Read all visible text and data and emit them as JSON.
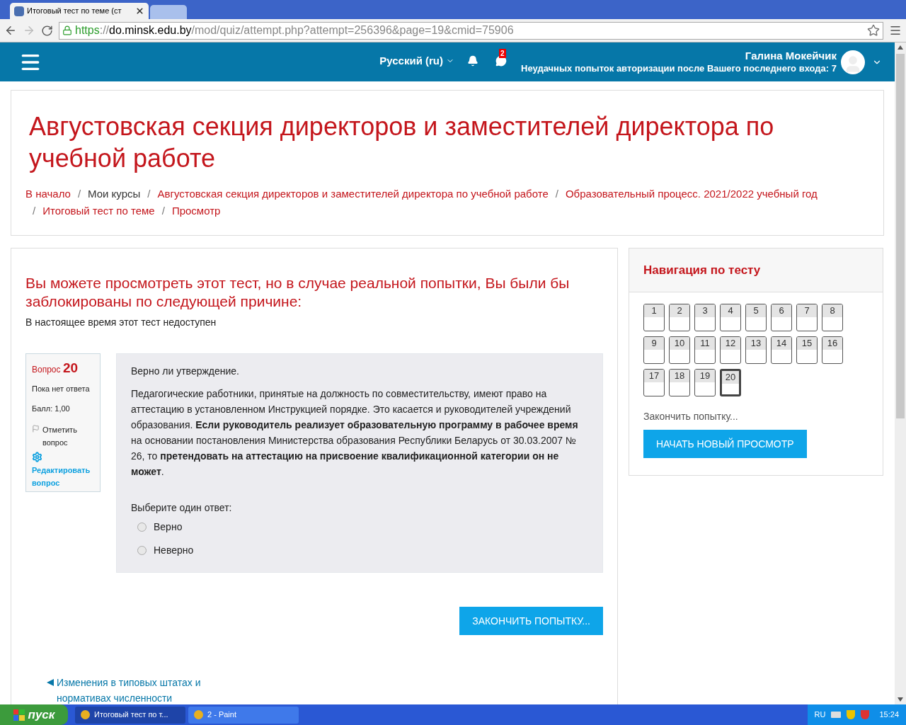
{
  "browser": {
    "tabs": [
      {
        "title": "Итоговый тест по теме (ст",
        "selected": true
      },
      {
        "selected": false
      }
    ],
    "url": {
      "scheme": "https",
      "separator": "://",
      "host": "do.minsk.edu.by",
      "path": "/mod/quiz/attempt.php?attempt=256396&page=19&cmid=75906"
    }
  },
  "navbar": {
    "language": "Русский (ru)",
    "message_count": "2",
    "user_name": "Галина Мокейчик",
    "login_notice": "Неудачных попыток авторизации после Вашего последнего входа: 7"
  },
  "header": {
    "title": "Августовская секция директоров и заместителей директора по учебной работе",
    "breadcrumbs": [
      {
        "label": "В начало",
        "link": true
      },
      {
        "separator": "/",
        "label": "Мои курсы",
        "link": false
      },
      {
        "separator": "/",
        "label": "Августовская секция директоров и заместителей директора по учебной работе",
        "link": true
      },
      {
        "separator": "/",
        "label": "Образовательный процесс. 2021/2022 учебный год",
        "link": true
      },
      {
        "separator": "/",
        "label": "Итоговый тест по теме",
        "link": true
      },
      {
        "separator": "/",
        "label": "Просмотр",
        "link": true
      }
    ]
  },
  "quiz": {
    "notice_title": "Вы можете просмотреть этот тест, но в случае реальной попытки, Вы были бы заблокированы по следующей причине:",
    "notice_text": "В настоящее время этот тест недоступен",
    "info": {
      "label": "Вопрос",
      "number": "20",
      "status": "Пока нет ответа",
      "grade": "Балл: 1,00",
      "flag": "Отметить вопрос",
      "edit": "Редактировать вопрос"
    },
    "question": {
      "intro": "Верно ли утверждение.",
      "text": "Педагогические работники, принятые на должность по совместительству, имеют право на аттестацию в установленном Инструкцией порядке. Это касается и руководителей учреждений образования. **Если руководитель реализует образовательную программу в рабочее время** на основании постановления Министерства образования Республики Беларусь от 30.03.2007 № 26, то **претендовать на аттестацию на присвоение квалификационной категории он не может**.",
      "prompt": "Выберите один ответ:",
      "answers": [
        {
          "label": "Верно",
          "selected": false
        },
        {
          "label": "Неверно",
          "selected": false
        }
      ]
    },
    "finish_button": "ЗАКОНЧИТЬ ПОПЫТКУ...",
    "prev_link": "Изменения в типовых штатах и нормативах численности"
  },
  "navigation": {
    "title": "Навигация по тесту",
    "buttons": [
      {
        "label": "1",
        "selected": false
      },
      {
        "label": "2",
        "selected": false
      },
      {
        "label": "3",
        "selected": false
      },
      {
        "label": "4",
        "selected": false
      },
      {
        "label": "5",
        "selected": false
      },
      {
        "label": "6",
        "selected": false
      },
      {
        "label": "7",
        "selected": false
      },
      {
        "label": "8",
        "selected": false
      },
      {
        "label": "9",
        "selected": false
      },
      {
        "label": "10",
        "selected": false
      },
      {
        "label": "11",
        "selected": false
      },
      {
        "label": "12",
        "selected": false
      },
      {
        "label": "13",
        "selected": false
      },
      {
        "label": "14",
        "selected": false
      },
      {
        "label": "15",
        "selected": false
      },
      {
        "label": "16",
        "selected": false
      },
      {
        "label": "17",
        "selected": false
      },
      {
        "label": "18",
        "selected": false
      },
      {
        "label": "19",
        "selected": false
      },
      {
        "label": "20",
        "selected": true
      }
    ],
    "finish_link": "Закончить попытку...",
    "new_preview_button": "НАЧАТЬ НОВЫЙ ПРОСМОТР"
  },
  "taskbar": {
    "start": "пуск",
    "tasks": [
      {
        "label": "Итоговый тест по т...",
        "selected": true
      },
      {
        "label": "2 - Paint",
        "selected": false
      }
    ],
    "language": "RU",
    "time": "15:24"
  }
}
